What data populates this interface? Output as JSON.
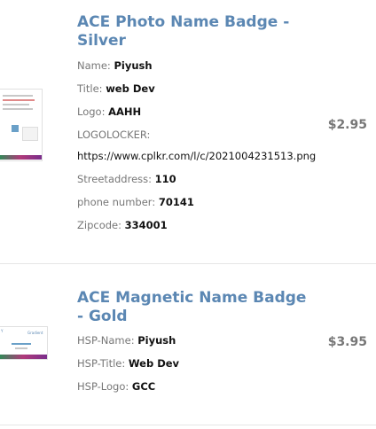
{
  "items": [
    {
      "title": "ACE Photo Name Badge - Silver",
      "price": "$2.95",
      "attrs": [
        {
          "label": "Name:",
          "value": "Piyush"
        },
        {
          "label": "Title:",
          "value": "web Dev"
        },
        {
          "label": "Logo:",
          "value": "AAHH"
        },
        {
          "label": "LOGOLOCKER:",
          "value": ""
        },
        {
          "label": "",
          "value": "https://www.cplkr.com/l/c/2021004231513.png"
        },
        {
          "label": "Streetaddress:",
          "value": "110"
        },
        {
          "label": "phone number:",
          "value": "70141"
        },
        {
          "label": "Zipcode:",
          "value": "334001"
        }
      ]
    },
    {
      "title": "ACE Magnetic Name Badge - Gold",
      "price": "$3.95",
      "attrs": [
        {
          "label": "HSP-Name:",
          "value": "Piyush"
        },
        {
          "label": "HSP-Title:",
          "value": "Web Dev"
        },
        {
          "label": "HSP-Logo:",
          "value": "GCC"
        }
      ]
    }
  ],
  "colors": {
    "title": "#5b87b3",
    "price": "#777777",
    "label": "#777777",
    "value": "#111111"
  }
}
